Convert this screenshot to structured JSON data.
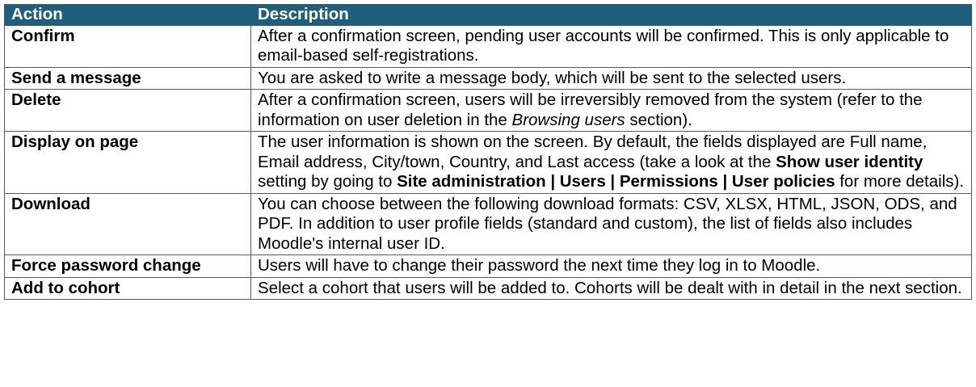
{
  "columns": [
    "Action",
    "Description"
  ],
  "rows": [
    {
      "action": "Confirm",
      "parts": [
        {
          "t": "After a confirmation screen, pending user accounts will be confirmed. This is only applicable to email-based self-registrations.",
          "s": ""
        }
      ]
    },
    {
      "action": "Send a message",
      "parts": [
        {
          "t": "You are asked to write a message body, which will be sent to the selected users.",
          "s": ""
        }
      ]
    },
    {
      "action": "Delete",
      "parts": [
        {
          "t": "After a confirmation screen, users will be irreversibly removed from the system (refer to the information on user deletion in the ",
          "s": ""
        },
        {
          "t": "Browsing users",
          "s": "i"
        },
        {
          "t": " section).",
          "s": ""
        }
      ]
    },
    {
      "action": "Display on page",
      "parts": [
        {
          "t": "The user information is shown on the screen. By default, the fields displayed are Full name, Email address, City/town, Country, and Last access (take a look at the ",
          "s": ""
        },
        {
          "t": "Show user identity",
          "s": "b"
        },
        {
          "t": " setting by going to ",
          "s": ""
        },
        {
          "t": "Site administration | Users | Permissions | User policies",
          "s": "b"
        },
        {
          "t": " for more details).",
          "s": ""
        }
      ]
    },
    {
      "action": "Download",
      "parts": [
        {
          "t": "You can choose between the following download formats: CSV, XLSX, HTML, JSON, ODS, and PDF. In addition to user profile fields (standard and custom), the list of fields also includes Moodle's internal user ID.",
          "s": ""
        }
      ]
    },
    {
      "action": "Force password change",
      "parts": [
        {
          "t": "Users will have to change their password the next time they log in to Moodle.",
          "s": ""
        }
      ]
    },
    {
      "action": "Add to cohort",
      "parts": [
        {
          "t": "Select a cohort that users will be added to. Cohorts will be dealt with in detail in the next section.",
          "s": ""
        }
      ]
    }
  ]
}
